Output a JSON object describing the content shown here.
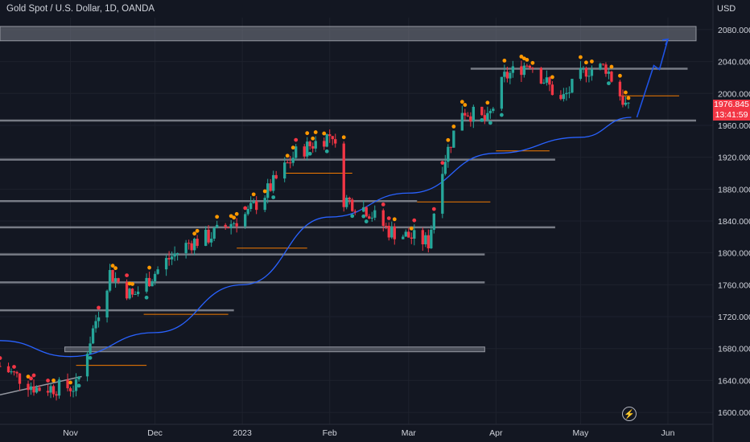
{
  "header": {
    "title": "Gold Spot / U.S. Dollar, 1D, OANDA",
    "currency": "USD"
  },
  "price_tag": {
    "price": "1976.845",
    "countdown": "13:41:59"
  },
  "colors": {
    "background": "#131722",
    "bull": "#26a69a",
    "bear": "#f23645",
    "ma": "#2962ff",
    "zone": "#787b86",
    "orange": "#f57c00",
    "dot_red": "#f23645",
    "dot_orange": "#ff9800",
    "dot_green": "#26a69a",
    "projection": "#1e53e5"
  },
  "icons": {
    "replay": "lightning-icon"
  },
  "chart_data": {
    "type": "candlestick",
    "title": "Gold Spot / U.S. Dollar, 1D, OANDA",
    "y_unit": "USD",
    "ylim": [
      1585,
      2095
    ],
    "y_ticks": [
      1600,
      1640,
      1680,
      1720,
      1760,
      1800,
      1840,
      1880,
      1920,
      1960,
      2000,
      2040,
      2080
    ],
    "y_tick_labels": [
      "1600.000",
      "1640.000",
      "1680.000",
      "1720.000",
      "1760.000",
      "1800.000",
      "1840.000",
      "1880.000",
      "1920.000",
      "1960.000",
      "2000.000",
      "2040.000",
      "2080.000"
    ],
    "x_ticks": [
      {
        "date": "2022-11-01",
        "label": "Nov"
      },
      {
        "date": "2022-12-01",
        "label": "Dec"
      },
      {
        "date": "2023-01-01",
        "label": "2023"
      },
      {
        "date": "2023-02-01",
        "label": "Feb"
      },
      {
        "date": "2023-03-01",
        "label": "Mar"
      },
      {
        "date": "2023-04-01",
        "label": "Apr"
      },
      {
        "date": "2023-05-01",
        "label": "May"
      },
      {
        "date": "2023-06-01",
        "label": "Jun"
      }
    ],
    "xlim": [
      "2022-10-07",
      "2023-06-17"
    ],
    "anchor_closes": [
      {
        "date": "2022-10-07",
        "value": 1658
      },
      {
        "date": "2022-10-20",
        "value": 1630
      },
      {
        "date": "2022-11-03",
        "value": 1632
      },
      {
        "date": "2022-11-15",
        "value": 1775
      },
      {
        "date": "2022-11-23",
        "value": 1745
      },
      {
        "date": "2022-12-05",
        "value": 1790
      },
      {
        "date": "2022-12-13",
        "value": 1812
      },
      {
        "date": "2022-12-20",
        "value": 1820
      },
      {
        "date": "2023-01-03",
        "value": 1850
      },
      {
        "date": "2023-01-10",
        "value": 1878
      },
      {
        "date": "2023-01-20",
        "value": 1925
      },
      {
        "date": "2023-02-02",
        "value": 1950
      },
      {
        "date": "2023-02-06",
        "value": 1868
      },
      {
        "date": "2023-02-14",
        "value": 1855
      },
      {
        "date": "2023-02-22",
        "value": 1828
      },
      {
        "date": "2023-03-08",
        "value": 1813
      },
      {
        "date": "2023-03-13",
        "value": 1910
      },
      {
        "date": "2023-03-20",
        "value": 1980
      },
      {
        "date": "2023-03-29",
        "value": 1965
      },
      {
        "date": "2023-04-04",
        "value": 2020
      },
      {
        "date": "2023-04-13",
        "value": 2040
      },
      {
        "date": "2023-04-24",
        "value": 1990
      },
      {
        "date": "2023-05-03",
        "value": 2030
      },
      {
        "date": "2023-05-10",
        "value": 2033
      },
      {
        "date": "2023-05-18",
        "value": 1978
      }
    ],
    "moving_average": [
      {
        "date": "2022-10-07",
        "value": 1690
      },
      {
        "date": "2022-11-01",
        "value": 1670
      },
      {
        "date": "2022-12-01",
        "value": 1700
      },
      {
        "date": "2023-01-01",
        "value": 1760
      },
      {
        "date": "2023-02-01",
        "value": 1845
      },
      {
        "date": "2023-03-01",
        "value": 1875
      },
      {
        "date": "2023-04-01",
        "value": 1925
      },
      {
        "date": "2023-05-01",
        "value": 1945
      },
      {
        "date": "2023-05-19",
        "value": 1970
      }
    ],
    "zones": [
      {
        "y1": 2066,
        "y2": 2084,
        "x1": "2022-10-07",
        "x2": "2023-06-11",
        "style": "band"
      },
      {
        "y1": 1676,
        "y2": 1682,
        "x1": "2022-10-30",
        "x2": "2023-03-28",
        "style": "band"
      }
    ],
    "levels": [
      {
        "y": 2031,
        "x1": "2023-03-23",
        "x2": "2023-06-08"
      },
      {
        "y": 1966,
        "x1": "2022-10-07",
        "x2": "2023-06-11"
      },
      {
        "y": 1917,
        "x1": "2022-10-07",
        "x2": "2023-04-22"
      },
      {
        "y": 1865,
        "x1": "2022-10-07",
        "x2": "2023-03-04"
      },
      {
        "y": 1832,
        "x1": "2022-10-07",
        "x2": "2023-04-22"
      },
      {
        "y": 1798,
        "x1": "2022-10-07",
        "x2": "2023-03-28"
      },
      {
        "y": 1763,
        "x1": "2022-10-07",
        "x2": "2023-03-28"
      },
      {
        "y": 1728,
        "x1": "2022-10-07",
        "x2": "2022-12-29"
      }
    ],
    "orange_levels": [
      {
        "y": 1997,
        "x1": "2023-05-15",
        "x2": "2023-06-05"
      },
      {
        "y": 1928,
        "x1": "2023-04-01",
        "x2": "2023-04-20"
      },
      {
        "y": 1900,
        "x1": "2023-01-16",
        "x2": "2023-02-09"
      },
      {
        "y": 1864,
        "x1": "2023-03-04",
        "x2": "2023-03-30"
      },
      {
        "y": 1806,
        "x1": "2022-12-30",
        "x2": "2023-01-24"
      },
      {
        "y": 1723,
        "x1": "2022-11-27",
        "x2": "2022-12-27"
      },
      {
        "y": 1659,
        "x1": "2022-11-03",
        "x2": "2022-11-28"
      }
    ],
    "trendline": [
      {
        "date": "2022-10-07",
        "value": 1622
      },
      {
        "date": "2022-11-05",
        "value": 1645
      }
    ],
    "projection": [
      {
        "date": "2023-05-21",
        "value": 1970
      },
      {
        "date": "2023-05-27",
        "value": 2035
      },
      {
        "date": "2023-05-29",
        "value": 2030
      },
      {
        "date": "2023-06-01",
        "value": 2068
      }
    ]
  }
}
